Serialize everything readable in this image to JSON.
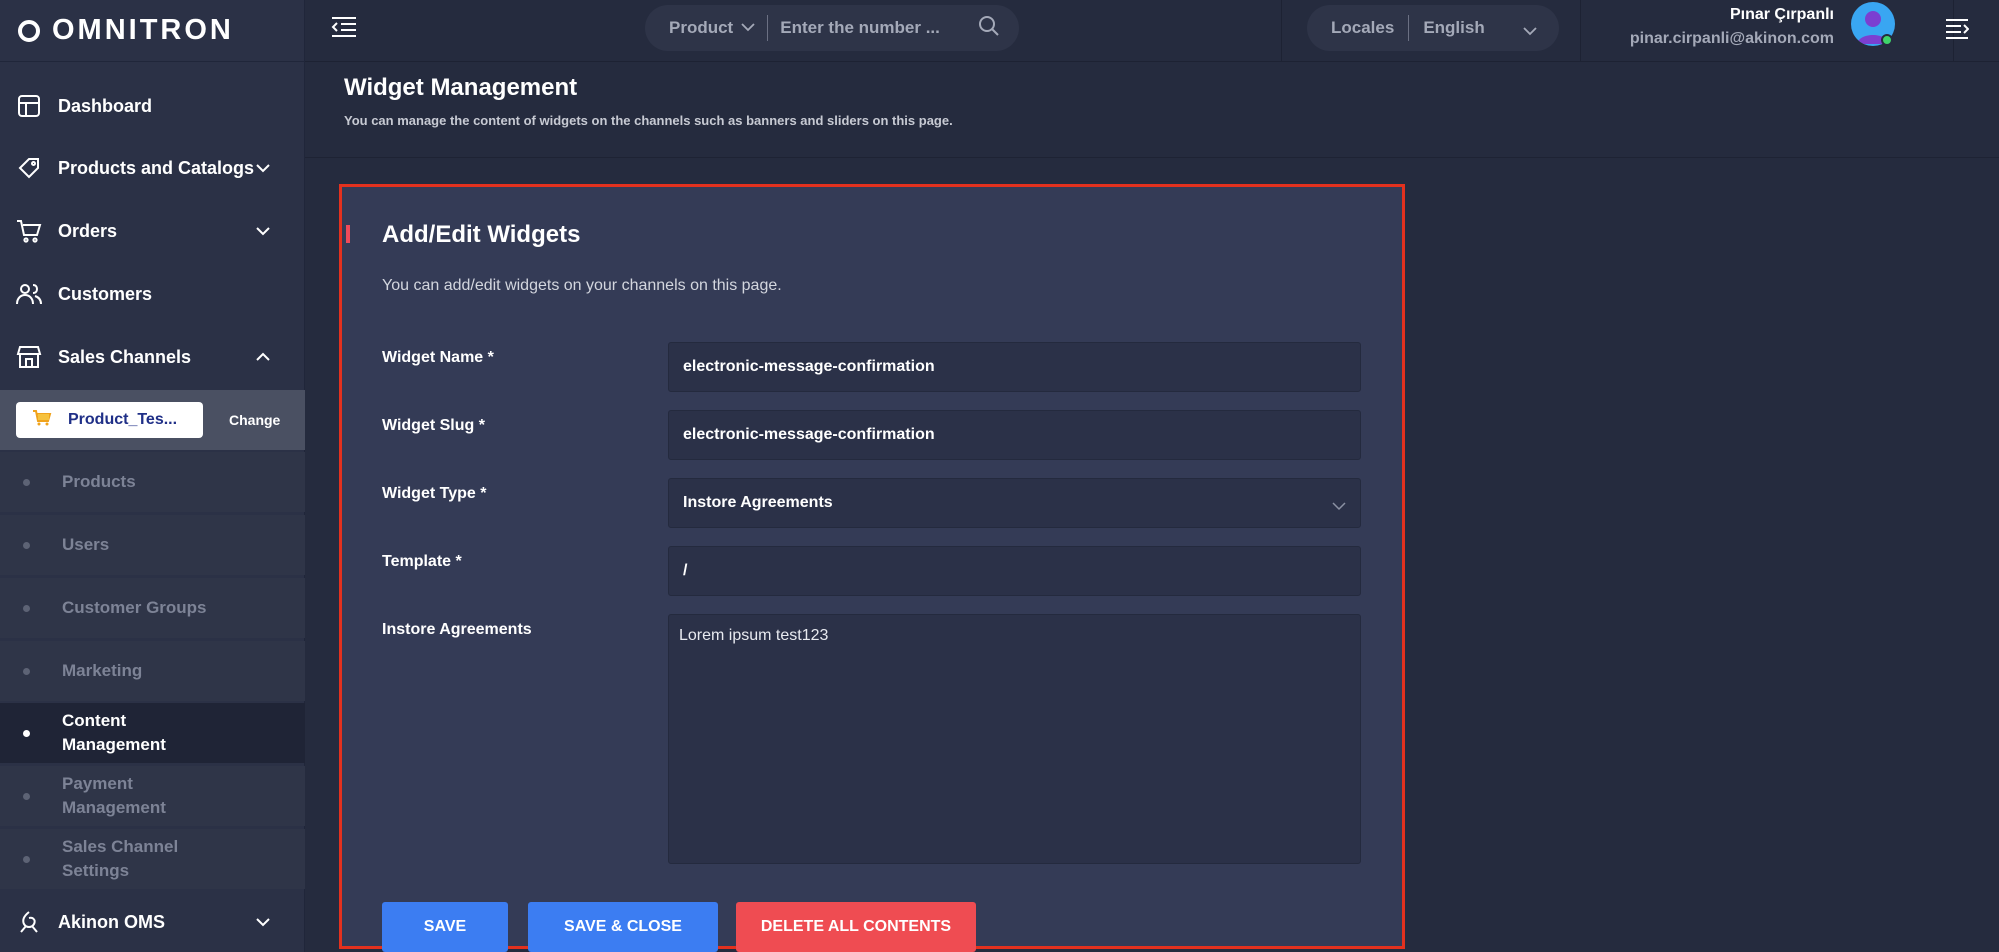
{
  "brand": {
    "name": "OMNITRON"
  },
  "sidebar": {
    "items": [
      {
        "label": "Dashboard",
        "icon": "layout-icon"
      },
      {
        "label": "Products and Catalogs",
        "icon": "tag-icon"
      },
      {
        "label": "Orders",
        "icon": "cart-icon"
      },
      {
        "label": "Customers",
        "icon": "users-icon"
      },
      {
        "label": "Sales Channels",
        "icon": "store-icon"
      }
    ],
    "channel": {
      "name": "Product_Tes...",
      "change_label": "Change"
    },
    "sub_items": [
      {
        "label": "Products"
      },
      {
        "label": "Users"
      },
      {
        "label": "Customer Groups"
      },
      {
        "label": "Marketing"
      },
      {
        "label": "Content Management"
      },
      {
        "label": "Payment Management"
      },
      {
        "label": "Sales Channel Settings"
      }
    ],
    "bottom_item": {
      "label": "Akinon OMS",
      "icon": "akinon-icon"
    }
  },
  "topbar": {
    "search_type": "Product",
    "search_placeholder": "Enter the number ...",
    "locale_label": "Locales",
    "locale_value": "English",
    "user_name": "Pınar Çırpanlı",
    "user_email": "pinar.cirpanli@akinon.com"
  },
  "page": {
    "title": "Widget Management",
    "subtitle": "You can manage the content of widgets on the channels such as banners and sliders on this page."
  },
  "form": {
    "title": "Add/Edit Widgets",
    "description": "You can add/edit widgets on your channels on this page.",
    "fields": {
      "name": {
        "label": "Widget Name *",
        "value": "electronic-message-confirmation"
      },
      "slug": {
        "label": "Widget Slug *",
        "value": "electronic-message-confirmation"
      },
      "type": {
        "label": "Widget Type *",
        "value": "Instore Agreements"
      },
      "template": {
        "label": "Template *",
        "value": "/"
      },
      "agreements": {
        "label": "Instore Agreements",
        "value": "Lorem ipsum test123"
      }
    },
    "buttons": {
      "save": "SAVE",
      "save_close": "SAVE & CLOSE",
      "delete_all": "DELETE ALL CONTENTS"
    }
  },
  "colors": {
    "accent_blue": "#3c7df2",
    "danger_red": "#ef4c52",
    "highlight_border": "#e3311e"
  }
}
